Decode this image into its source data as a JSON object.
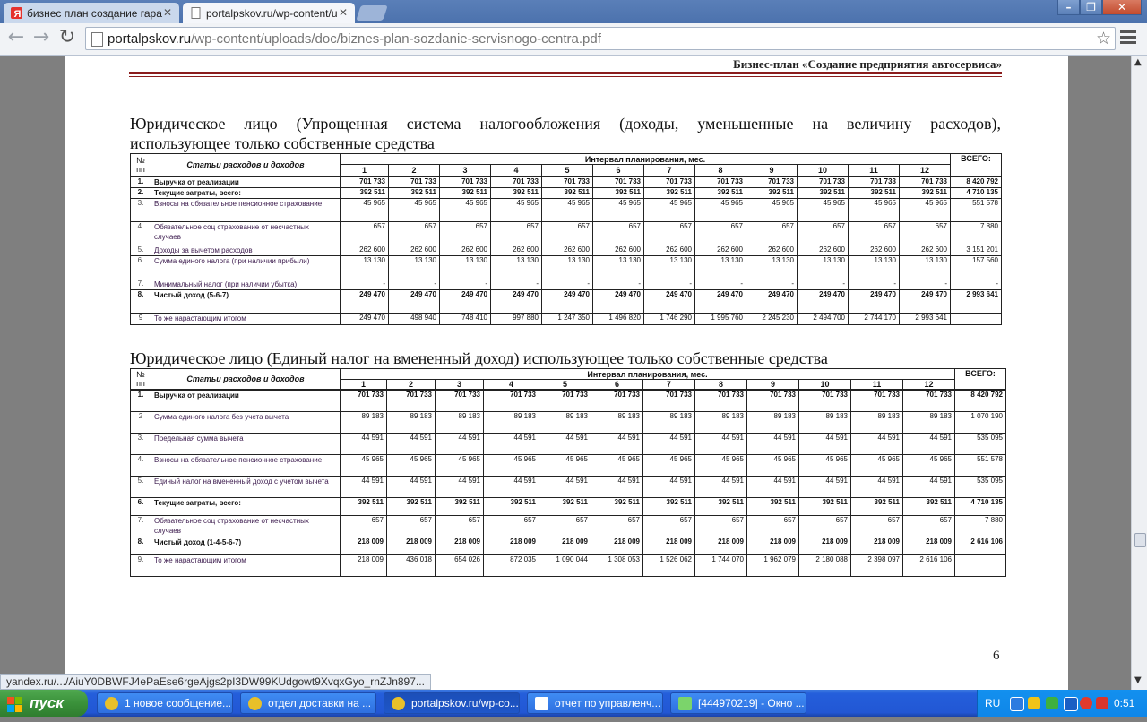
{
  "browser": {
    "tabs": [
      {
        "title": "бизнес план создание гара",
        "favicon": "yandex-icon"
      },
      {
        "title": "portalpskov.ru/wp-content/u",
        "favicon": "page-icon"
      }
    ],
    "url_domain": "portalpskov.ru",
    "url_path": "/wp-content/uploads/doc/biznes-plan-sozdanie-servisnogo-centra.pdf",
    "status_url": "yandex.ru/.../AiuY0DBWFJ4ePaEse6rgeAjgs2pI3DW99KUdgowt9XvqxGyo_rnZJn897..."
  },
  "document": {
    "header": "Бизнес-план «Создание предприятия автосервиса»",
    "page_number": "6",
    "table1": {
      "heading_line1": "Юридическое лицо (Упрощенная система налогообложения (доходы, уменьшенные на величину расходов),",
      "heading_line2": "использующее только собственные средства",
      "h_no": "№ пп",
      "h_items": "Статьи расходов и доходов",
      "h_interval": "Интервал планирования, мес.",
      "h_total": "ВСЕГО:",
      "months": [
        "1",
        "2",
        "3",
        "4",
        "5",
        "6",
        "7",
        "8",
        "9",
        "10",
        "11",
        "12"
      ],
      "rows": [
        {
          "no": "1.",
          "name": "Выручка от реализации",
          "bold": true,
          "values": [
            "701 733",
            "701 733",
            "701 733",
            "701 733",
            "701 733",
            "701 733",
            "701 733",
            "701 733",
            "701 733",
            "701 733",
            "701 733",
            "701 733"
          ],
          "total": "8 420 792"
        },
        {
          "no": "2.",
          "name": "Текущие затраты, всего:",
          "bold": true,
          "values": [
            "392 511",
            "392 511",
            "392 511",
            "392 511",
            "392 511",
            "392 511",
            "392 511",
            "392 511",
            "392 511",
            "392 511",
            "392 511",
            "392 511"
          ],
          "total": "4 710 135"
        },
        {
          "no": "3.",
          "name": "Взносы на обязательное пенсионное страхование",
          "bold": false,
          "values": [
            "45 965",
            "45 965",
            "45 965",
            "45 965",
            "45 965",
            "45 965",
            "45 965",
            "45 965",
            "45 965",
            "45 965",
            "45 965",
            "45 965"
          ],
          "total": "551 578"
        },
        {
          "no": "4.",
          "name": "Обязательное соц страхование от несчастных случаев",
          "bold": false,
          "values": [
            "657",
            "657",
            "657",
            "657",
            "657",
            "657",
            "657",
            "657",
            "657",
            "657",
            "657",
            "657"
          ],
          "total": "7 880"
        },
        {
          "no": "5.",
          "name": "Доходы за вычетом расходов",
          "bold": false,
          "values": [
            "262 600",
            "262 600",
            "262 600",
            "262 600",
            "262 600",
            "262 600",
            "262 600",
            "262 600",
            "262 600",
            "262 600",
            "262 600",
            "262 600"
          ],
          "total": "3 151 201"
        },
        {
          "no": "6.",
          "name": "Сумма единого налога (при наличии прибыли)",
          "bold": false,
          "values": [
            "13 130",
            "13 130",
            "13 130",
            "13 130",
            "13 130",
            "13 130",
            "13 130",
            "13 130",
            "13 130",
            "13 130",
            "13 130",
            "13 130"
          ],
          "total": "157 560"
        },
        {
          "no": "7.",
          "name": "Минимальный налог (при наличии убытка)",
          "bold": false,
          "values": [
            "-",
            "-",
            "-",
            "-",
            "-",
            "-",
            "-",
            "-",
            "-",
            "-",
            "-",
            "-"
          ],
          "total": "-"
        },
        {
          "no": "8.",
          "name": "Чистый доход (5-6-7)",
          "bold": true,
          "values": [
            "249 470",
            "249 470",
            "249 470",
            "249 470",
            "249 470",
            "249 470",
            "249 470",
            "249 470",
            "249 470",
            "249 470",
            "249 470",
            "249 470"
          ],
          "total": "2 993 641"
        },
        {
          "no": "9",
          "name": "То же нарастающим итогом",
          "bold": false,
          "values": [
            "249 470",
            "498 940",
            "748 410",
            "997 880",
            "1 247 350",
            "1 496 820",
            "1 746 290",
            "1 995 760",
            "2 245 230",
            "2 494 700",
            "2 744 170",
            "2 993 641"
          ],
          "total": ""
        }
      ]
    },
    "table2": {
      "heading": "Юридическое лицо (Единый налог на вмененный доход) использующее только собственные средства",
      "h_no": "№ пп",
      "h_items": "Статьи расходов и доходов",
      "h_interval": "Интервал планирования, мес.",
      "h_total": "ВСЕГО:",
      "months": [
        "1",
        "2",
        "3",
        "4",
        "5",
        "6",
        "7",
        "8",
        "9",
        "10",
        "11",
        "12"
      ],
      "rows": [
        {
          "no": "1.",
          "name": "Выручка от реализации",
          "bold": true,
          "values": [
            "701 733",
            "701 733",
            "701 733",
            "701 733",
            "701 733",
            "701 733",
            "701 733",
            "701 733",
            "701 733",
            "701 733",
            "701 733",
            "701 733"
          ],
          "total": "8 420 792"
        },
        {
          "no": "2",
          "name": "Сумма единого налога без учета вычета",
          "bold": false,
          "values": [
            "89 183",
            "89 183",
            "89 183",
            "89 183",
            "89 183",
            "89 183",
            "89 183",
            "89 183",
            "89 183",
            "89 183",
            "89 183",
            "89 183"
          ],
          "total": "1 070 190"
        },
        {
          "no": "3.",
          "name": "Предельная сумма вычета",
          "bold": false,
          "values": [
            "44 591",
            "44 591",
            "44 591",
            "44 591",
            "44 591",
            "44 591",
            "44 591",
            "44 591",
            "44 591",
            "44 591",
            "44 591",
            "44 591"
          ],
          "total": "535 095"
        },
        {
          "no": "4.",
          "name": "Взносы на обязательное пенсионное страхование",
          "bold": false,
          "values": [
            "45 965",
            "45 965",
            "45 965",
            "45 965",
            "45 965",
            "45 965",
            "45 965",
            "45 965",
            "45 965",
            "45 965",
            "45 965",
            "45 965"
          ],
          "total": "551 578"
        },
        {
          "no": "5.",
          "name": "Единый налог на вмененный доход с учетом вычета",
          "bold": false,
          "values": [
            "44 591",
            "44 591",
            "44 591",
            "44 591",
            "44 591",
            "44 591",
            "44 591",
            "44 591",
            "44 591",
            "44 591",
            "44 591",
            "44 591"
          ],
          "total": "535 095"
        },
        {
          "no": "6.",
          "name": "Текущие затраты, всего:",
          "bold": true,
          "values": [
            "392 511",
            "392 511",
            "392 511",
            "392 511",
            "392 511",
            "392 511",
            "392 511",
            "392 511",
            "392 511",
            "392 511",
            "392 511",
            "392 511"
          ],
          "total": "4 710 135"
        },
        {
          "no": "7.",
          "name": "Обязательное соц страхование от несчастных случаев",
          "bold": false,
          "values": [
            "657",
            "657",
            "657",
            "657",
            "657",
            "657",
            "657",
            "657",
            "657",
            "657",
            "657",
            "657"
          ],
          "total": "7 880"
        },
        {
          "no": "8.",
          "name": "Чистый доход (1-4-5-6-7)",
          "bold": true,
          "values": [
            "218 009",
            "218 009",
            "218 009",
            "218 009",
            "218 009",
            "218 009",
            "218 009",
            "218 009",
            "218 009",
            "218 009",
            "218 009",
            "218 009"
          ],
          "total": "2 616 106"
        },
        {
          "no": "9.",
          "name": "То же нарастающим итогом",
          "bold": false,
          "values": [
            "218 009",
            "436 018",
            "654 026",
            "872 035",
            "1 090 044",
            "1 308 053",
            "1 526 062",
            "1 744 070",
            "1 962 079",
            "2 180 088",
            "2 398 097",
            "2 616 106"
          ],
          "total": ""
        }
      ]
    }
  },
  "taskbar": {
    "start": "пуск",
    "tasks": [
      {
        "label": "1 новое сообщение....",
        "icon": "chrome-icon"
      },
      {
        "label": "отдел доставки на ...",
        "icon": "chrome-icon"
      },
      {
        "label": "portalpskov.ru/wp-co...",
        "icon": "chrome-icon"
      },
      {
        "label": "отчет по управленч...",
        "icon": "word-icon"
      },
      {
        "label": "[444970219] - Окно ...",
        "icon": "chat-icon"
      }
    ],
    "lang": "RU",
    "time": "0:51"
  }
}
